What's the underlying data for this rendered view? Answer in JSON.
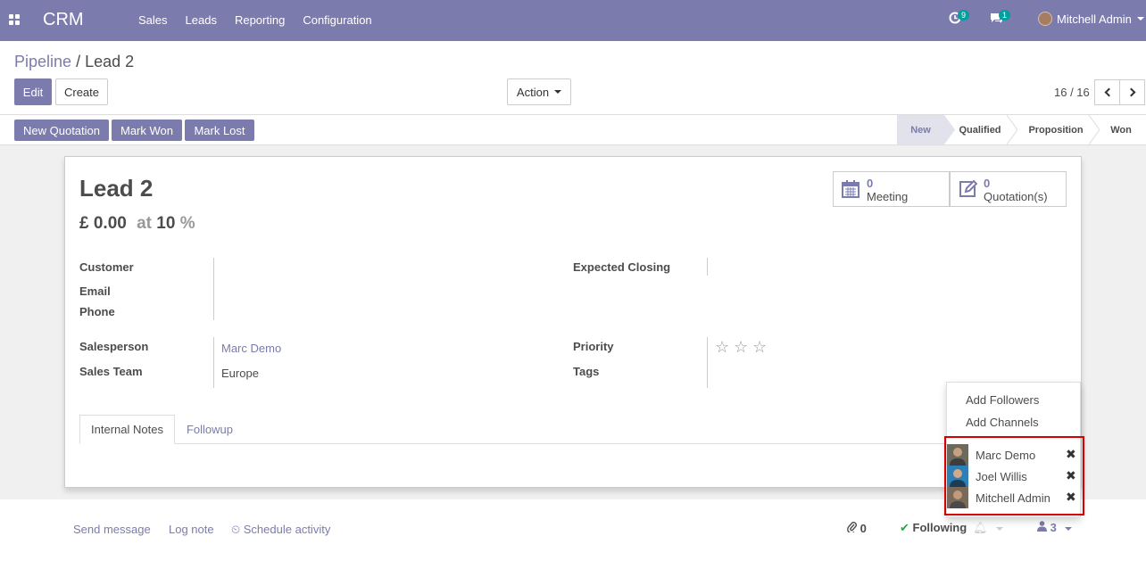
{
  "navbar": {
    "brand": "CRM",
    "menu": [
      "Sales",
      "Leads",
      "Reporting",
      "Configuration"
    ],
    "activity_badge": "9",
    "messages_badge": "1",
    "user_name": "Mitchell Admin"
  },
  "control": {
    "breadcrumb_parent": "Pipeline",
    "breadcrumb_sep": "/",
    "breadcrumb_current": "Lead 2",
    "edit_label": "Edit",
    "create_label": "Create",
    "action_label": "Action",
    "pager": "16 / 16"
  },
  "statusbar": {
    "buttons": [
      "New Quotation",
      "Mark Won",
      "Mark Lost"
    ],
    "stages": [
      "New",
      "Qualified",
      "Proposition",
      "Won"
    ],
    "active_stage": "New"
  },
  "form": {
    "title": "Lead 2",
    "revenue": "£ 0.00",
    "at_label": "at",
    "probability": "10",
    "percent": "%",
    "smart_buttons": [
      {
        "count": "0",
        "label": "Meeting",
        "icon": "calendar-icon"
      },
      {
        "count": "0",
        "label": "Quotation(s)",
        "icon": "edit-icon"
      }
    ],
    "fields": {
      "customer_label": "Customer",
      "email_label": "Email",
      "phone_label": "Phone",
      "expected_closing_label": "Expected Closing",
      "salesperson_label": "Salesperson",
      "salesperson_value": "Marc Demo",
      "sales_team_label": "Sales Team",
      "sales_team_value": "Europe",
      "priority_label": "Priority",
      "tags_label": "Tags"
    },
    "tabs": [
      "Internal Notes",
      "Followup"
    ]
  },
  "chatter": {
    "send_message": "Send message",
    "log_note": "Log note",
    "schedule_activity": "Schedule activity",
    "attachments_count": "0",
    "following_label": "Following",
    "followers_count": "3"
  },
  "followers_dropdown": {
    "add_followers": "Add Followers",
    "add_channels": "Add Channels",
    "followers": [
      "Marc Demo",
      "Joel Willis",
      "Mitchell Admin"
    ]
  },
  "colors": {
    "brand": "#7c7bad",
    "highlight": "#d90000",
    "following": "#28a745"
  }
}
